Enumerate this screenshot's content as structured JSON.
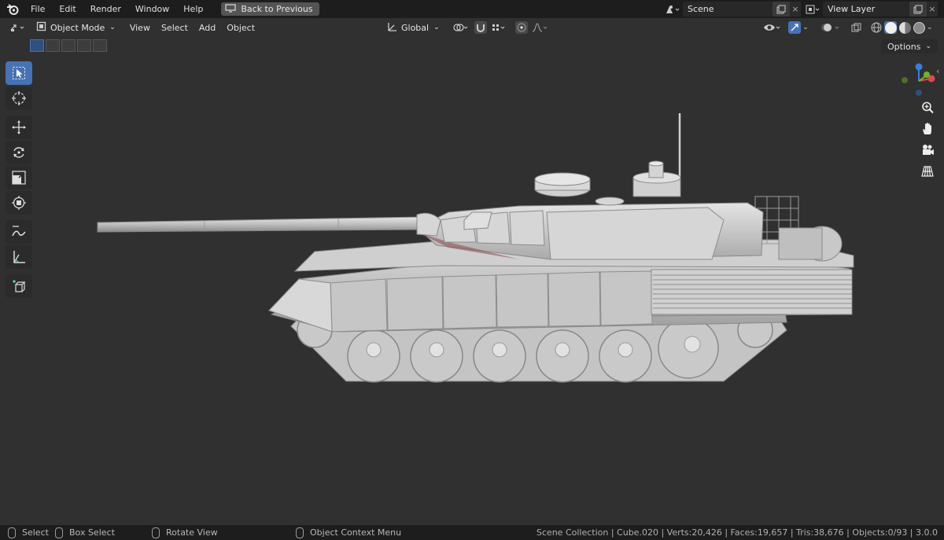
{
  "menubar": {
    "items": [
      "File",
      "Edit",
      "Render",
      "Window",
      "Help"
    ],
    "back_button": "Back to Previous",
    "scene_name": "Scene",
    "view_layer_name": "View Layer"
  },
  "header": {
    "mode": "Object Mode",
    "menu": [
      "View",
      "Select",
      "Add",
      "Object"
    ],
    "transform_orientation": "Global"
  },
  "viewport": {
    "options_label": "Options"
  },
  "statusbar": {
    "select": "Select",
    "box_select": "Box Select",
    "rotate_view": "Rotate View",
    "context_menu": "Object Context Menu",
    "stats": "Scene Collection | Cube.020 | Verts:20,426 | Faces:19,657 | Tris:38,676 | Objects:0/93 | 3.0.0"
  },
  "colors": {
    "accent": "#4772b3",
    "axis_x": "#e0484f",
    "axis_y": "#6fb423",
    "axis_z": "#3b7ddd"
  },
  "icons": {
    "tools": [
      "select-box-icon",
      "cursor-icon",
      "move-icon",
      "rotate-icon",
      "scale-icon",
      "transform-icon",
      "annotate-icon",
      "measure-icon",
      "add-cube-icon"
    ],
    "nav": [
      "zoom-icon",
      "pan-hand-icon",
      "camera-icon",
      "perspective-grid-icon"
    ]
  }
}
